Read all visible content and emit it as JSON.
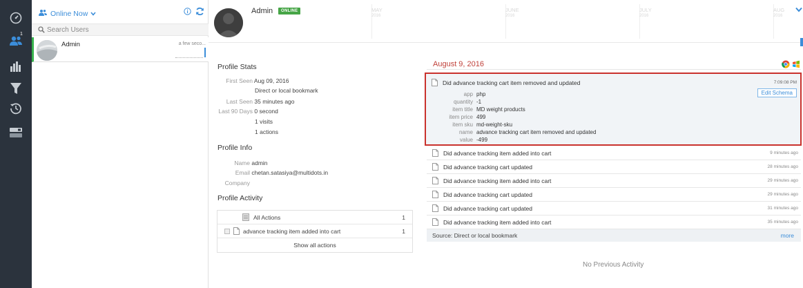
{
  "users_panel": {
    "online_label": "Online Now",
    "search_placeholder": "Search Users",
    "user": {
      "name": "Admin",
      "time": "a few seco..."
    },
    "rail_badge": "1"
  },
  "profile": {
    "name": "Admin",
    "status_badge": "ONLINE"
  },
  "timeline": {
    "months": [
      {
        "name": "MAY",
        "year": "2016"
      },
      {
        "name": "JUNE",
        "year": "2016"
      },
      {
        "name": "JULY",
        "year": "2016"
      },
      {
        "name": "AUG",
        "year": "2016"
      }
    ]
  },
  "stats": {
    "title": "Profile Stats",
    "first_seen_label": "First Seen",
    "first_seen_value": "Aug 09, 2016",
    "first_seen_source": "Direct or local bookmark",
    "last_seen_label": "Last Seen",
    "last_seen_value": "35 minutes ago",
    "last90_label": "Last 90 Days",
    "last90_value": "0 second",
    "visits": "1 visits",
    "actions": "1 actions"
  },
  "info": {
    "title": "Profile Info",
    "name_label": "Name",
    "name_value": "admin",
    "email_label": "Email",
    "email_value": "chetan.satasiya@multidots.in",
    "company_label": "Company"
  },
  "activity": {
    "title": "Profile Activity",
    "rows": [
      {
        "label": "All Actions",
        "count": "1"
      },
      {
        "label": "advance tracking item added into cart",
        "count": "1"
      }
    ],
    "show_all": "Show all actions"
  },
  "feed": {
    "date": "August 9, 2016",
    "highlighted": {
      "title": "Did advance tracking cart item removed and updated",
      "time": "7:09:08 PM",
      "edit_label": "Edit Schema",
      "props": [
        {
          "k": "app",
          "v": "php"
        },
        {
          "k": "quantity",
          "v": "-1"
        },
        {
          "k": "item title",
          "v": "MD weight products"
        },
        {
          "k": "item price",
          "v": "499"
        },
        {
          "k": "item sku",
          "v": "md-weight-sku"
        },
        {
          "k": "name",
          "v": "advance tracking cart item removed and updated"
        },
        {
          "k": "value",
          "v": "-499"
        }
      ]
    },
    "events": [
      {
        "title": "Did advance tracking item added into cart",
        "time": "9 minutes ago"
      },
      {
        "title": "Did advance tracking cart updated",
        "time": "28 minutes ago"
      },
      {
        "title": "Did advance tracking item added into cart",
        "time": "29 minutes ago"
      },
      {
        "title": "Did advance tracking cart updated",
        "time": "29 minutes ago"
      },
      {
        "title": "Did advance tracking cart updated",
        "time": "31 minutes ago"
      },
      {
        "title": "Did advance tracking item added into cart",
        "time": "35 minutes ago"
      }
    ],
    "source": "Source: Direct or local bookmark",
    "more": "more",
    "no_previous": "No Previous Activity"
  },
  "colors": {
    "rail": "#2b333d",
    "accent": "#3b8dd9",
    "online": "#46a546",
    "highlight_border": "#c9312c",
    "date": "#c0413a"
  },
  "icons": {
    "rail": [
      "dashboard-icon",
      "users-icon",
      "bar-chart-icon",
      "funnel-icon",
      "history-icon",
      "toggle-icon"
    ],
    "header": [
      "users-icon",
      "chevron-down-icon",
      "info-icon",
      "refresh-icon"
    ],
    "feed": [
      "chrome-icon",
      "windows-icon",
      "document-icon"
    ]
  }
}
